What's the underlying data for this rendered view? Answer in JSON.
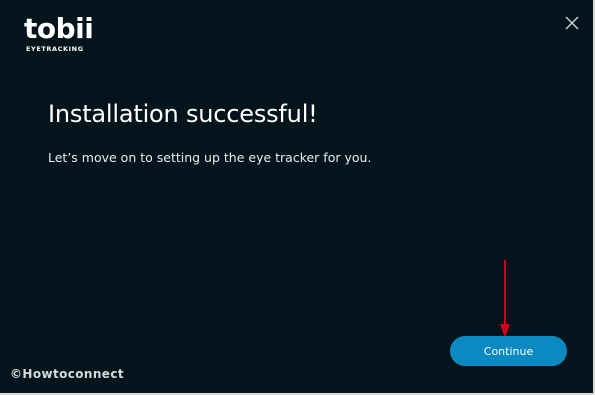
{
  "logo": {
    "word": "tobii",
    "tagline": "EYETRACKING"
  },
  "window": {
    "close_icon": "close-icon"
  },
  "main": {
    "title": "Installation successful!",
    "subtitle": "Let’s move on to setting up the eye tracker for you."
  },
  "footer": {
    "continue_label": "Continue"
  },
  "annotation": {
    "arrow_icon": "red-arrow-down-icon",
    "arrow_color": "#d0021b"
  },
  "watermark": {
    "text": "©Howtoconnect"
  },
  "colors": {
    "background": "#03141d",
    "accent": "#0b8ac2",
    "text": "#ffffff"
  }
}
